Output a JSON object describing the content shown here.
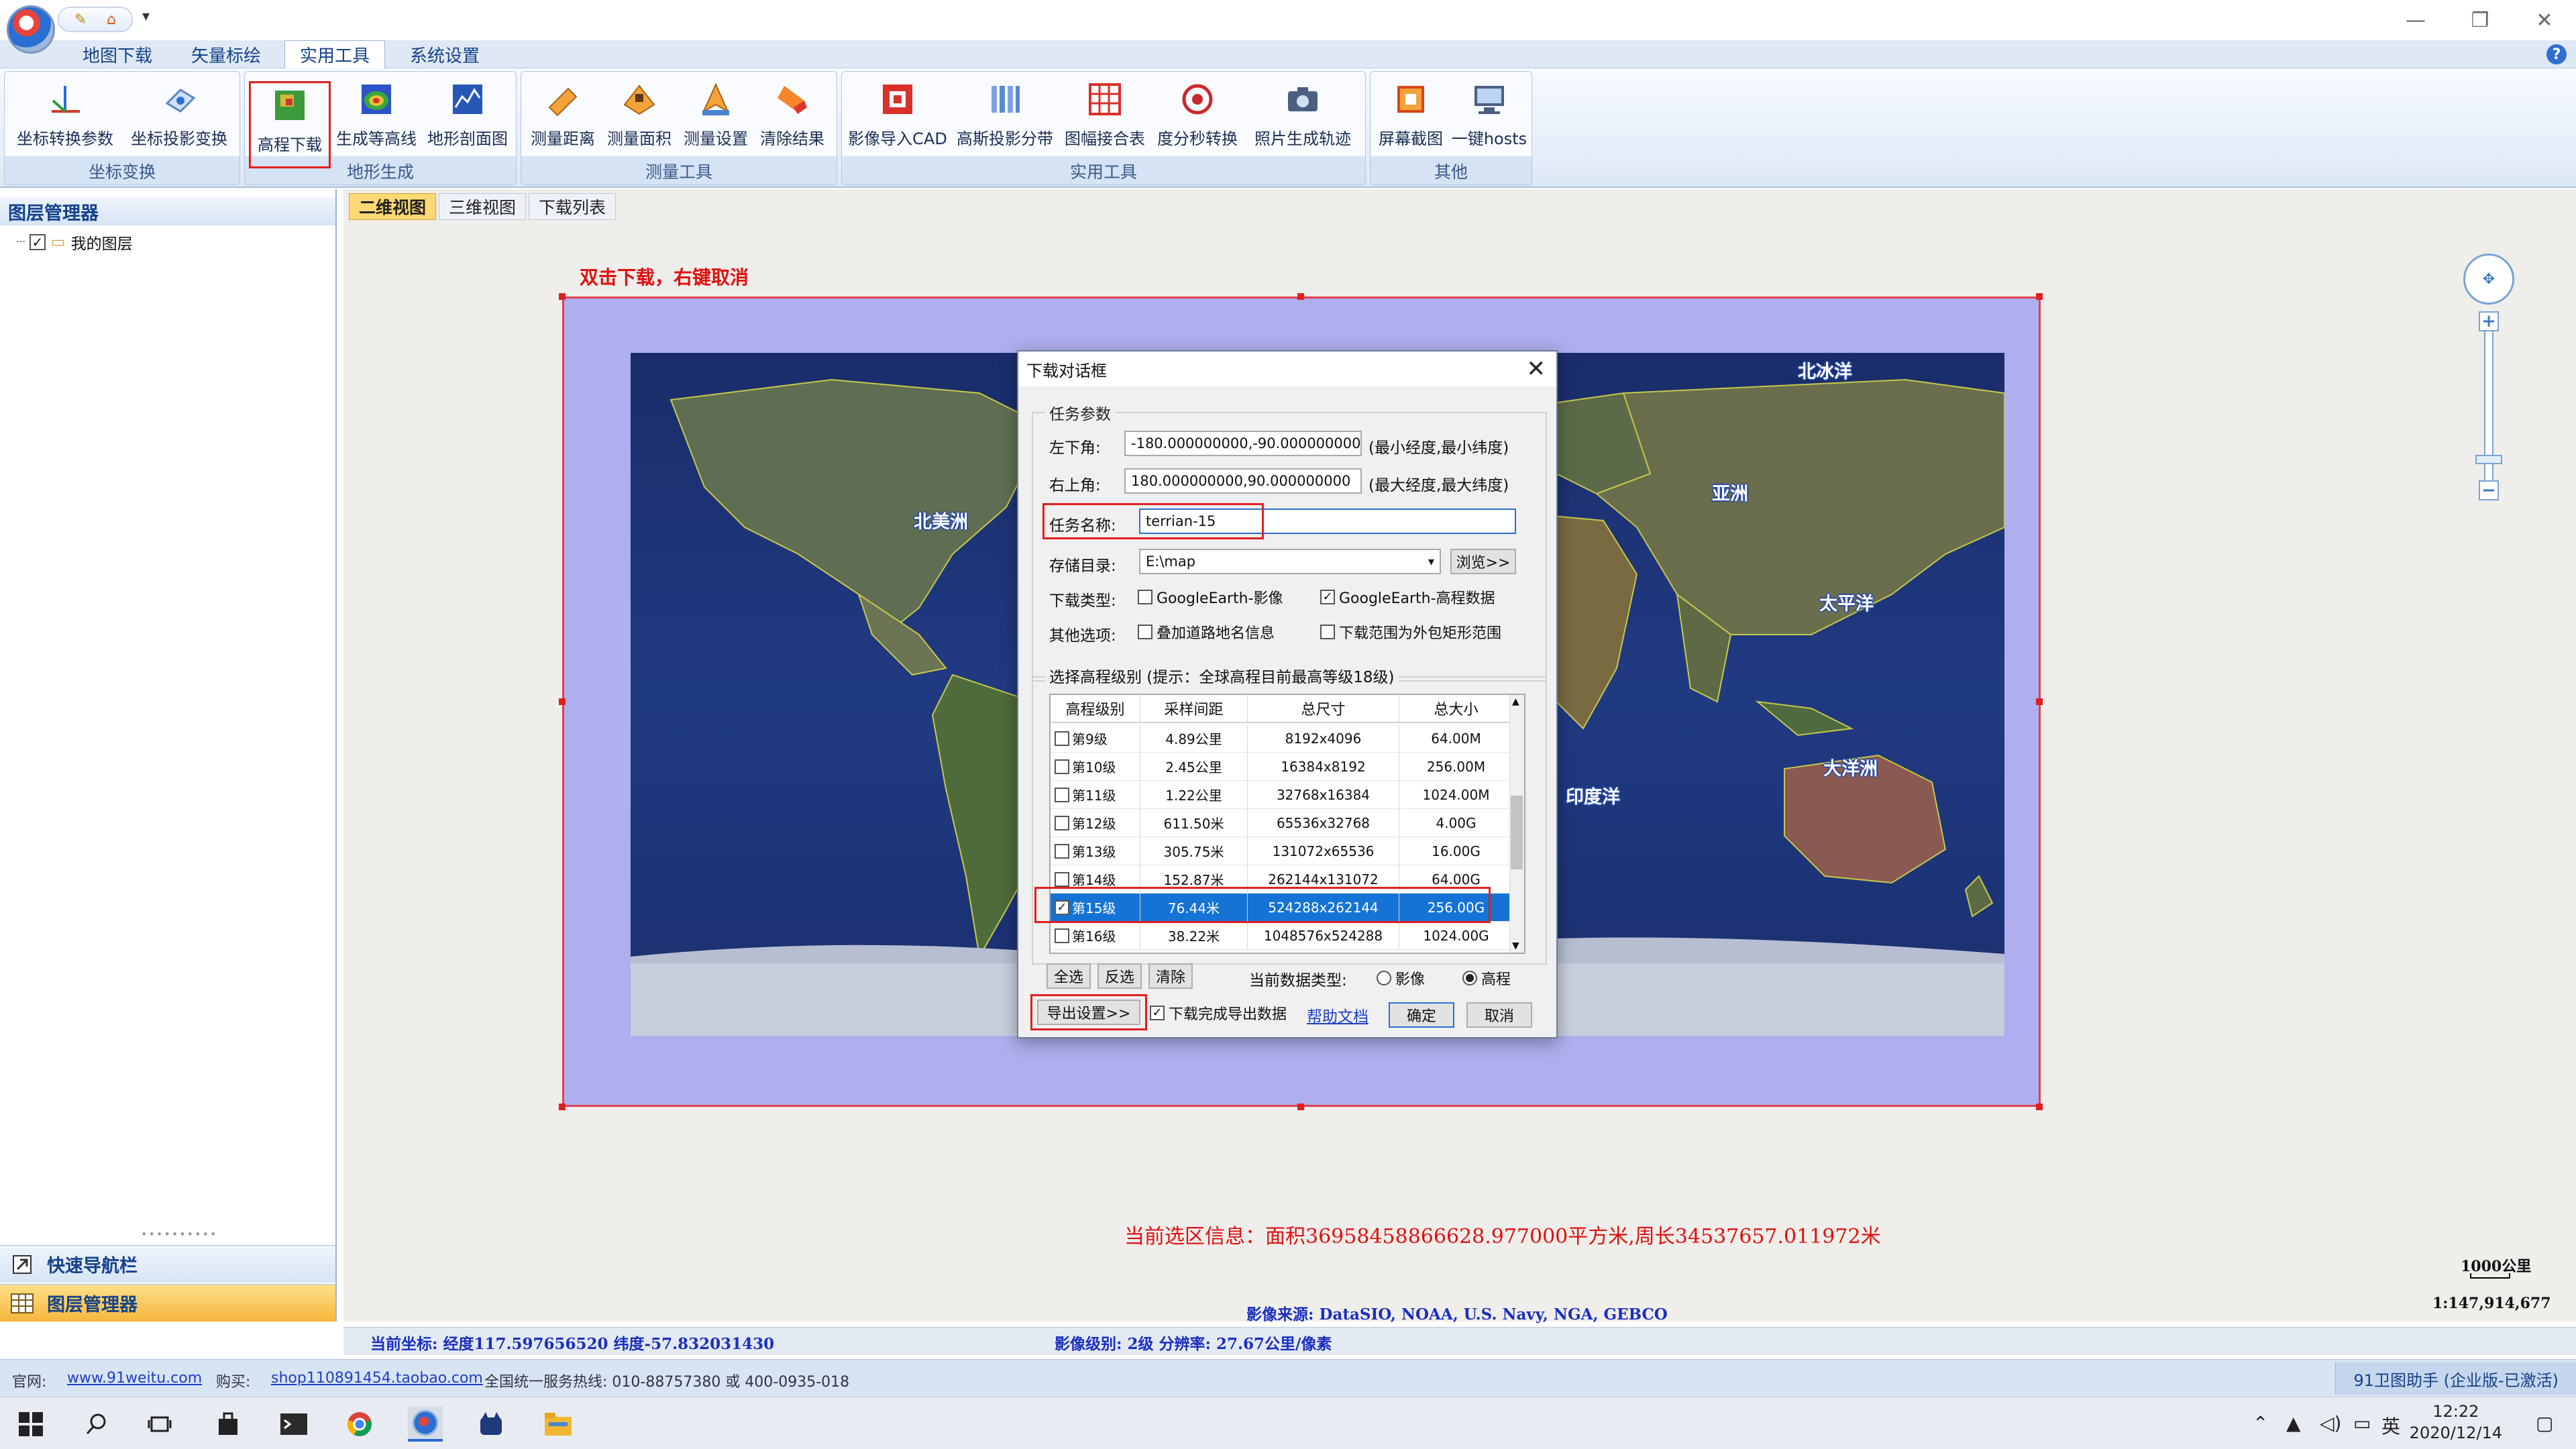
{
  "window": {
    "minimize": "—",
    "restore": "❐",
    "close": "✕",
    "help": "?"
  },
  "qat": {
    "icon1": "✎",
    "icon2": "⌂",
    "more": "▾"
  },
  "menu": [
    "地图下载",
    "矢量标绘",
    "实用工具",
    "系统设置"
  ],
  "ribbon": {
    "groups": [
      {
        "label": "坐标变换",
        "buttons": [
          "坐标转换参数",
          "坐标投影变换"
        ]
      },
      {
        "label": "地形生成",
        "buttons": [
          "高程下载",
          "生成等高线",
          "地形剖面图"
        ]
      },
      {
        "label": "测量工具",
        "buttons": [
          "测量距离",
          "测量面积",
          "测量设置",
          "清除结果"
        ]
      },
      {
        "label": "实用工具",
        "buttons": [
          "影像导入CAD",
          "高斯投影分带",
          "图幅接合表",
          "度分秒转换",
          "照片生成轨迹"
        ]
      },
      {
        "label": "其他",
        "buttons": [
          "屏幕截图",
          "一键hosts"
        ]
      }
    ]
  },
  "left_panel": {
    "title": "图层管理器",
    "tree_root": "我的图层",
    "grip": "••••••••••",
    "nav_items": [
      "快速导航栏",
      "图层管理器"
    ]
  },
  "view_tabs": [
    "二维视图",
    "三维视图",
    "下载列表"
  ],
  "map": {
    "hint": "双击下载，右键取消",
    "labels": [
      "北冰洋",
      "亚洲",
      "北美洲",
      "太平洋",
      "大洋洲",
      "印度洋"
    ],
    "selection_info": "当前选区信息：面积36958458866628.977000平方米,周长34537657.011972米",
    "scale_label": "1000公里",
    "scale_ratio": "1:147,914,677",
    "source": "影像来源:  DataSIO, NOAA, U.S. Navy, NGA, GEBCO",
    "coord": "当前坐标: 经度117.597656520 纬度-57.832031430",
    "level_info": "影像级别: 2级 分辨率: 27.67公里/像素",
    "zoom_in": "+",
    "zoom_out": "−",
    "nav_arrows": "✥"
  },
  "dialog": {
    "title": "下载对话框",
    "close": "✕",
    "section_params": "任务参数",
    "lower_left_label": "左下角:",
    "lower_left_value": "-180.000000000,-90.000000000",
    "lower_left_hint": "(最小经度,最小纬度)",
    "upper_right_label": "右上角:",
    "upper_right_value": "180.000000000,90.000000000",
    "upper_right_hint": "(最大经度,最大纬度)",
    "task_name_label": "任务名称:",
    "task_name_value": "terrian-15",
    "dir_label": "存储目录:",
    "dir_value": "E:\\map",
    "browse": "浏览>>",
    "type_label": "下载类型:",
    "type_image": "GoogleEarth-影像",
    "type_dem": "GoogleEarth-高程数据",
    "other_label": "其他选项:",
    "other_road": "叠加道路地名信息",
    "other_rect": "下载范围为外包矩形范围",
    "section_level": "选择高程级别 (提示：全球高程目前最高等级18级)",
    "grid_headers": [
      "高程级别",
      "采样间距",
      "总尺寸",
      "总大小"
    ],
    "grid_rows": [
      {
        "level": "第9级",
        "spacing": "4.89公里",
        "dims": "8192x4096",
        "size": "64.00M",
        "checked": false
      },
      {
        "level": "第10级",
        "spacing": "2.45公里",
        "dims": "16384x8192",
        "size": "256.00M",
        "checked": false
      },
      {
        "level": "第11级",
        "spacing": "1.22公里",
        "dims": "32768x16384",
        "size": "1024.00M",
        "checked": false
      },
      {
        "level": "第12级",
        "spacing": "611.50米",
        "dims": "65536x32768",
        "size": "4.00G",
        "checked": false
      },
      {
        "level": "第13级",
        "spacing": "305.75米",
        "dims": "131072x65536",
        "size": "16.00G",
        "checked": false
      },
      {
        "level": "第14级",
        "spacing": "152.87米",
        "dims": "262144x131072",
        "size": "64.00G",
        "checked": false
      },
      {
        "level": "第15级",
        "spacing": "76.44米",
        "dims": "524288x262144",
        "size": "256.00G",
        "checked": true
      },
      {
        "level": "第16级",
        "spacing": "38.22米",
        "dims": "1048576x524288",
        "size": "1024.00G",
        "checked": false
      }
    ],
    "btn_all": "全选",
    "btn_invert": "反选",
    "btn_clear": "清除",
    "data_type_label": "当前数据类型:",
    "radio_image": "影像",
    "radio_dem": "高程",
    "export_settings": "导出设置>>",
    "export_after": "下载完成导出数据",
    "help_doc": "帮助文档",
    "ok": "确定",
    "cancel": "取消"
  },
  "statusbar": {
    "site_label": "官网:",
    "site": "www.91weitu.com",
    "buy_label": "购买:",
    "shop": "shop110891454.taobao.com",
    "hotline": "全国统一服务热线: 010-88757380 或 400-0935-018",
    "right": "91卫图助手 (企业版-已激活)"
  },
  "taskbar": {
    "tray_ime": "英",
    "time": "12:22",
    "date": "2020/12/14"
  },
  "colors": {
    "accent": "#1573d6",
    "selection": "#9696f0",
    "alert": "#e01010"
  }
}
